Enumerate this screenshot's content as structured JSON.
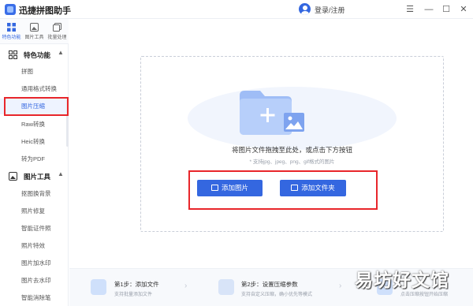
{
  "app": {
    "title": "迅捷拼图助手"
  },
  "account": {
    "login_label": "登录/注册"
  },
  "window": {
    "menu": "☰",
    "minimize": "—",
    "maximize": "☐",
    "close": "✕"
  },
  "rail": [
    {
      "label": "特色功能",
      "icon": "grid-icon"
    },
    {
      "label": "图片工具",
      "icon": "image-tool-icon"
    },
    {
      "label": "批量处理",
      "icon": "batch-icon"
    }
  ],
  "sidebar": {
    "section1": {
      "label": "特色功能",
      "caret": "▲"
    },
    "section1_items": [
      "拼图",
      "通用格式转换",
      "图片压缩",
      "Raw转换",
      "Heic转换",
      "转为PDF"
    ],
    "section2": {
      "label": "图片工具",
      "caret": "▲"
    },
    "section2_items": [
      "抠图换背景",
      "照片修复",
      "智能证件照",
      "照片特效",
      "图片加水印",
      "图片去水印",
      "智能消除笔"
    ]
  },
  "dropzone": {
    "main_text": "将图片文件拖拽至此处，或点击下方按钮",
    "sub_text": "* 支持jpg、jpeg、png、gif格式的图片",
    "add_image_label": "添加图片",
    "add_folder_label": "添加文件夹"
  },
  "steps": [
    {
      "title": "第1步：添加文件",
      "desc": "支持批量添加文件"
    },
    {
      "title": "第2步：设置压缩参数",
      "desc": "支持自定义压缩，确小优先等模式"
    },
    {
      "title": "",
      "desc": "点击压缩按钮开始压缩"
    }
  ],
  "watermark": "易坊好文馆",
  "colors": {
    "accent": "#3467e0",
    "annotation": "#e8262b"
  }
}
